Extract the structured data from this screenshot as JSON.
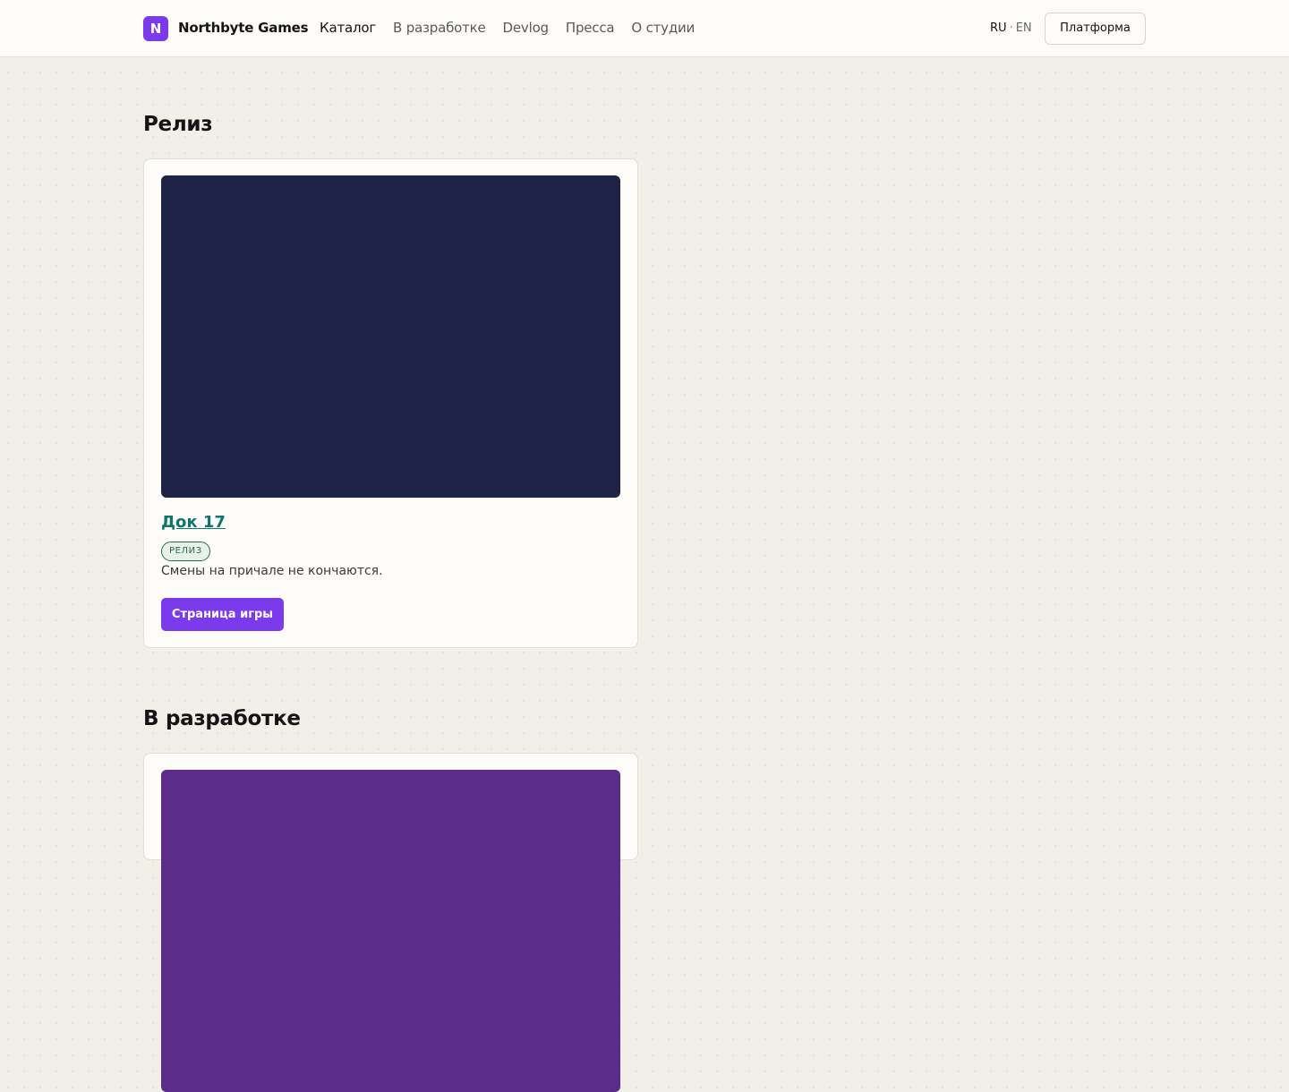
{
  "header": {
    "logo_letter": "N",
    "brand": "Northbyte Games",
    "nav": [
      "Каталог",
      "В разработке",
      "Devlog",
      "Пресса",
      "О студии"
    ],
    "lang_current": "RU",
    "lang_sep": "·",
    "lang_other": "EN",
    "platform_label": "Платформа"
  },
  "sections": [
    {
      "title": "Релиз",
      "card": {
        "cover_color": "#1e2347",
        "game_title": "Док 17",
        "badge": "РЕЛИЗ",
        "description": "Смены на причале не кончаются.",
        "cta_label": "Страница игры"
      }
    },
    {
      "title": "В разработке",
      "card": {
        "cover_color": "#5b2c8a"
      }
    }
  ],
  "colors": {
    "accent": "#7c3aed",
    "link": "#0f766e",
    "badge_text": "#2f6b4b",
    "badge_bg": "#e6f2ea",
    "background": "#f1efe8"
  }
}
